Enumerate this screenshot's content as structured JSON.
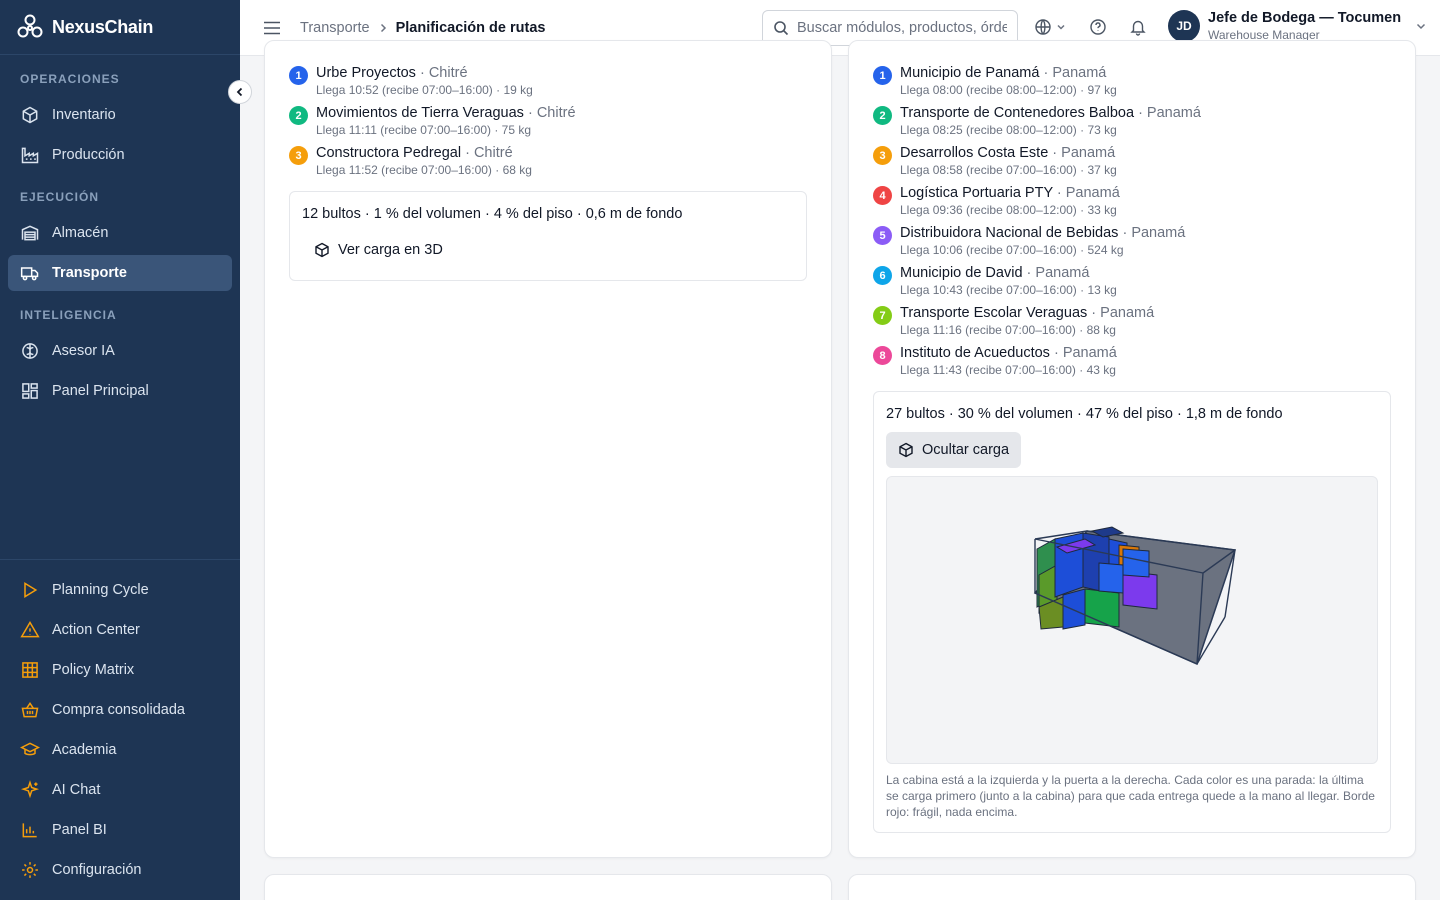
{
  "brand": {
    "name": "NexusChain"
  },
  "sidebar": {
    "sections": [
      {
        "label": "OPERACIONES",
        "items": [
          {
            "label": "Inventario",
            "icon": "box-icon"
          },
          {
            "label": "Producción",
            "icon": "factory-icon"
          }
        ]
      },
      {
        "label": "EJECUCIÓN",
        "items": [
          {
            "label": "Almacén",
            "icon": "warehouse-icon"
          },
          {
            "label": "Transporte",
            "icon": "truck-icon",
            "active": true
          }
        ]
      },
      {
        "label": "INTELIGENCIA",
        "items": [
          {
            "label": "Asesor IA",
            "icon": "brain-icon"
          },
          {
            "label": "Panel Principal",
            "icon": "dashboard-icon"
          }
        ]
      }
    ],
    "bottom_items": [
      {
        "label": "Planning Cycle",
        "icon": "play-icon"
      },
      {
        "label": "Action Center",
        "icon": "alert-triangle-icon"
      },
      {
        "label": "Policy Matrix",
        "icon": "grid-icon"
      },
      {
        "label": "Compra consolidada",
        "icon": "basket-icon"
      },
      {
        "label": "Academia",
        "icon": "graduation-cap-icon"
      },
      {
        "label": "AI Chat",
        "icon": "sparkles-icon"
      },
      {
        "label": "Panel BI",
        "icon": "bar-chart-icon"
      },
      {
        "label": "Configuración",
        "icon": "settings-icon"
      }
    ]
  },
  "header": {
    "breadcrumb_parent": "Transporte",
    "breadcrumb_current": "Planificación de rutas",
    "search_placeholder": "Buscar módulos, productos, órdenes...",
    "user_initials": "JD",
    "user_name": "Jefe de Bodega — Tocumen",
    "user_role": "Warehouse Manager"
  },
  "route_left": {
    "stops": [
      {
        "num": "1",
        "name": "Urbe Proyectos",
        "city": " · Chitré",
        "detail": "Llega 10:52 (recibe 07:00–16:00) · 19 kg",
        "color": "#2563eb"
      },
      {
        "num": "2",
        "name": "Movimientos de Tierra Veraguas",
        "city": " · Chitré",
        "detail": "Llega 11:11 (recibe 07:00–16:00) · 75 kg",
        "color": "#10b981"
      },
      {
        "num": "3",
        "name": "Constructora Pedregal",
        "city": " · Chitré",
        "detail": "Llega 11:52 (recibe 07:00–16:00) · 68 kg",
        "color": "#f59e0b"
      }
    ],
    "summary": "12 bultos · 1 % del volumen · 4 % del piso · 0,6 m de fondo",
    "load_button": "Ver carga en 3D"
  },
  "route_right": {
    "stops": [
      {
        "num": "1",
        "name": "Municipio de Panamá",
        "city": " · Panamá",
        "detail": "Llega 08:00 (recibe 08:00–12:00) · 97 kg",
        "color": "#2563eb"
      },
      {
        "num": "2",
        "name": "Transporte de Contenedores Balboa",
        "city": " · Panamá",
        "detail": "Llega 08:25 (recibe 08:00–12:00) · 73 kg",
        "color": "#10b981"
      },
      {
        "num": "3",
        "name": "Desarrollos Costa Este",
        "city": " · Panamá",
        "detail": "Llega 08:58 (recibe 07:00–16:00) · 37 kg",
        "color": "#f59e0b"
      },
      {
        "num": "4",
        "name": "Logística Portuaria PTY",
        "city": " · Panamá",
        "detail": "Llega 09:36 (recibe 08:00–12:00) · 33 kg",
        "color": "#ef4444"
      },
      {
        "num": "5",
        "name": "Distribuidora Nacional de Bebidas",
        "city": " · Panamá",
        "detail": "Llega 10:06 (recibe 07:00–16:00) · 524 kg",
        "color": "#8b5cf6"
      },
      {
        "num": "6",
        "name": "Municipio de David",
        "city": " · Panamá",
        "detail": "Llega 10:43 (recibe 07:00–16:00) · 13 kg",
        "color": "#0ea5e9"
      },
      {
        "num": "7",
        "name": "Transporte Escolar Veraguas",
        "city": " · Panamá",
        "detail": "Llega 11:16 (recibe 07:00–16:00) · 88 kg",
        "color": "#84cc16"
      },
      {
        "num": "8",
        "name": "Instituto de Acueductos",
        "city": " · Panamá",
        "detail": "Llega 11:43 (recibe 07:00–16:00) · 43 kg",
        "color": "#ec4899"
      }
    ],
    "summary": "27 bultos · 30 % del volumen · 47 % del piso · 1,8 m de fondo",
    "load_button": "Ocultar carga",
    "caption": "La cabina está a la izquierda y la puerta a la derecha. Cada color es una parada: la última se carga primero (junto a la cabina) para que cada entrega quede a la mano al llegar. Borde rojo: frágil, nada encima."
  }
}
